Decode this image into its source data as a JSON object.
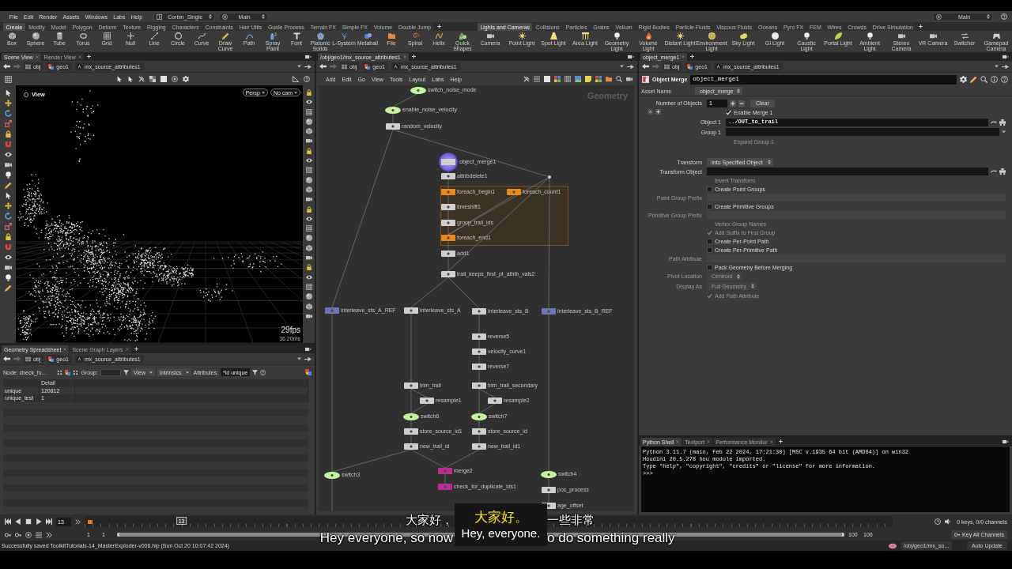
{
  "menu_bar": {
    "items": [
      "File",
      "Edit",
      "Render",
      "Assets",
      "Windows",
      "Labs",
      "Help"
    ],
    "desktop": "Corbin_Single",
    "desk_tab": "Main",
    "right_desk": "Main"
  },
  "shelf_left": {
    "tabs": [
      {
        "label": "Create",
        "selected": true
      },
      {
        "label": "Modify",
        "selected": false
      },
      {
        "label": "Model",
        "selected": false
      },
      {
        "label": "Polygon",
        "selected": false
      },
      {
        "label": "Deform",
        "selected": false
      },
      {
        "label": "Texture",
        "selected": false
      },
      {
        "label": "Rigging",
        "selected": false
      },
      {
        "label": "Characters",
        "selected": false
      },
      {
        "label": "Constraints",
        "selected": false
      },
      {
        "label": "Hair Utils",
        "selected": false
      },
      {
        "label": "Guide Process",
        "selected": false
      },
      {
        "label": "Terrain FX",
        "selected": false
      },
      {
        "label": "Simple FX",
        "selected": false
      },
      {
        "label": "Volume",
        "selected": false
      },
      {
        "label": "Double Jump",
        "selected": false
      }
    ],
    "tools": [
      "Box",
      "Sphere",
      "Tube",
      "Torus",
      "Grid",
      "Null",
      "Line",
      "Circle",
      "Curve",
      "Draw Curve",
      "Path",
      "Spray Paint",
      "Font",
      "Platonic Solids",
      "L-System",
      "Metaball",
      "File",
      "Spiral",
      "Helix",
      "Quick Shapes"
    ]
  },
  "shelf_right": {
    "tabs": [
      {
        "label": "Lights and Cameras",
        "selected": true
      },
      {
        "label": "Collisions",
        "selected": false
      },
      {
        "label": "Particles",
        "selected": false
      },
      {
        "label": "Grains",
        "selected": false
      },
      {
        "label": "Vellum",
        "selected": false
      },
      {
        "label": "Rigid Bodies",
        "selected": false
      },
      {
        "label": "Particle Fluids",
        "selected": false
      },
      {
        "label": "Viscous Fluids",
        "selected": false
      },
      {
        "label": "Oceans",
        "selected": false
      },
      {
        "label": "Pyro FX",
        "selected": false
      },
      {
        "label": "FEM",
        "selected": false
      },
      {
        "label": "Wires",
        "selected": false
      },
      {
        "label": "Crowds",
        "selected": false
      },
      {
        "label": "Drive Simulation",
        "selected": false
      }
    ],
    "tools": [
      "Camera",
      "Point Light",
      "Spot Light",
      "Area Light",
      "Geometry Light",
      "Volume Light",
      "Distant Light",
      "Environment Light",
      "Sky Light",
      "GI Light",
      "Caustic Light",
      "Portal Light",
      "Ambient Light",
      "Stereo Camera",
      "VR Camera",
      "Switcher",
      "Gamepad Camera"
    ]
  },
  "scene_view": {
    "tabs": [
      {
        "label": "Scene View",
        "selected": true
      },
      {
        "label": "Render View",
        "selected": false
      }
    ],
    "path": [
      "obj",
      "geo1",
      "mx_source_attributes1"
    ],
    "view_label": "View",
    "camera_menus": [
      "Persp",
      "No cam"
    ],
    "fps": "29fps",
    "frame_time": "36.20ms"
  },
  "spreadsheet": {
    "tabs": [
      {
        "label": "Geometry Spreadsheet",
        "selected": true
      },
      {
        "label": "Scene Graph Layers",
        "selected": false
      }
    ],
    "path": [
      "obj",
      "geo1",
      "mx_source_attributes1"
    ],
    "node_label": "Node: check_fo...",
    "group_label": "Group:",
    "view_menu": "View",
    "intrinsics_menu": "Intrinsics",
    "attributes_label": "Attributes:",
    "attributes_filter": "*id unique",
    "columns": [
      "Detail"
    ],
    "rows": [
      {
        "name": "unique",
        "value": "120812"
      },
      {
        "name": "unique_test",
        "value": "1"
      }
    ]
  },
  "network_editor": {
    "tabs": [
      {
        "label": "/obj/geo1/mx_source_attributes1",
        "selected": true
      }
    ],
    "path": [
      "obj",
      "geo1",
      "mx_source_attributes1"
    ],
    "menu": [
      "Add",
      "Edit",
      "Go",
      "View",
      "Tools",
      "Layout",
      "Labs",
      "Help"
    ],
    "context_label": "Geometry",
    "nodes": [
      {
        "name": "switch_noise_mode",
        "kind": "switch",
        "selected": false
      },
      {
        "name": "enable_noise_velocity",
        "kind": "switch",
        "selected": false
      },
      {
        "name": "random_velocity",
        "kind": "sop",
        "selected": false
      },
      {
        "name": "object_merge1",
        "kind": "sop",
        "selected": true
      },
      {
        "name": "attribdelete1",
        "kind": "sop",
        "selected": false
      },
      {
        "name": "foreach_begin1",
        "kind": "foreach",
        "selected": false
      },
      {
        "name": "foreach_count1",
        "kind": "foreach",
        "selected": false
      },
      {
        "name": "timeshift1",
        "kind": "sop",
        "selected": false
      },
      {
        "name": "group_trail_ids",
        "kind": "sop",
        "selected": false
      },
      {
        "name": "foreach_end1",
        "kind": "foreach",
        "selected": false
      },
      {
        "name": "add1",
        "kind": "sop",
        "selected": false
      },
      {
        "name": "trail_keeps_first_pt_attrib_vals2",
        "kind": "sop",
        "selected": false
      },
      {
        "name": "interleave_sts_A_REF",
        "kind": "reference",
        "selected": false
      },
      {
        "name": "interleave_sts_A",
        "kind": "sop",
        "selected": false
      },
      {
        "name": "interleave_sts_B",
        "kind": "sop",
        "selected": false
      },
      {
        "name": "interleave_sts_B_REF",
        "kind": "reference",
        "selected": false
      },
      {
        "name": "reverse5",
        "kind": "sop",
        "selected": false
      },
      {
        "name": "velocity_curve1",
        "kind": "sop",
        "selected": false
      },
      {
        "name": "reverse7",
        "kind": "sop",
        "selected": false
      },
      {
        "name": "trim_trail",
        "kind": "sop",
        "selected": false
      },
      {
        "name": "trim_trail_secondary",
        "kind": "sop",
        "selected": false
      },
      {
        "name": "resample1",
        "kind": "sop",
        "selected": false
      },
      {
        "name": "resample2",
        "kind": "sop",
        "selected": false
      },
      {
        "name": "switch6",
        "kind": "switch",
        "selected": false
      },
      {
        "name": "switch7",
        "kind": "switch",
        "selected": false
      },
      {
        "name": "store_source_id1",
        "kind": "sop",
        "selected": false
      },
      {
        "name": "store_source_id",
        "kind": "sop",
        "selected": false
      },
      {
        "name": "new_trail_id",
        "kind": "sop",
        "selected": false
      },
      {
        "name": "new_trail_id1",
        "kind": "sop",
        "selected": false
      },
      {
        "name": "switch3",
        "kind": "switch",
        "selected": false
      },
      {
        "name": "merge2",
        "kind": "merge",
        "selected": false
      },
      {
        "name": "check_for_duplicate_ids1",
        "kind": "merge",
        "selected": false
      },
      {
        "name": "switch4",
        "kind": "switch",
        "selected": false
      },
      {
        "name": "pos_process",
        "kind": "sop",
        "selected": false
      },
      {
        "name": "age_offset",
        "kind": "sop",
        "selected": false
      }
    ]
  },
  "parameters": {
    "tabs": [
      {
        "label": "object_merge1",
        "selected": true
      }
    ],
    "path": [
      "obj",
      "geo1",
      "mx_source_attributes1"
    ],
    "node_type": "Object Merge",
    "node_name": "object_merge1",
    "asset_name_label": "Asset Name",
    "asset_name": "object_merge",
    "rows": [
      {
        "kind": "multiparm",
        "label": "Number of Objects",
        "value": "1",
        "button": "Clear",
        "instances": [
          {
            "rows": [
              {
                "kind": "toggle",
                "label": "Enable Merge 1",
                "checked": true,
                "disabled": false
              },
              {
                "kind": "path",
                "label": "Object 1",
                "value": "../OUT_to_trail",
                "disabled": false
              },
              {
                "kind": "group",
                "label": "Group 1",
                "disabled": false
              },
              {
                "kind": "toggle",
                "label": "Expand Group 1",
                "checked": false,
                "disabled": true
              }
            ]
          }
        ]
      },
      {
        "kind": "menu",
        "label": "Transform",
        "value": "Into Specified Object",
        "disabled": false
      },
      {
        "kind": "path",
        "label": "Transform Object",
        "disabled": false
      },
      {
        "kind": "toggle",
        "label": "Invert Transform",
        "checked": false,
        "disabled": true
      },
      {
        "kind": "toggle",
        "label": "Create Point Groups",
        "checked": false,
        "disabled": false
      },
      {
        "kind": "field",
        "label": "Point Group Prefix",
        "disabled": true
      },
      {
        "kind": "toggle",
        "label": "Create Primitive Groups",
        "checked": false,
        "disabled": false
      },
      {
        "kind": "field",
        "label": "Primitive Group Prefix",
        "disabled": true
      },
      {
        "kind": "toggle",
        "label": "Vertex Group Names",
        "checked": false,
        "disabled": true
      },
      {
        "kind": "toggle",
        "label": "Add Suffix to First Group",
        "checked": true,
        "disabled": true
      },
      {
        "kind": "toggle",
        "label": "Create Per-Point Path",
        "checked": false,
        "disabled": false
      },
      {
        "kind": "toggle",
        "label": "Create Per-Primitive Path",
        "checked": false,
        "disabled": false
      },
      {
        "kind": "field",
        "label": "Path Attribute",
        "disabled": true
      },
      {
        "kind": "toggle",
        "label": "Pack Geometry Before Merging",
        "checked": false,
        "disabled": false
      },
      {
        "kind": "menu",
        "label": "Pivot Location",
        "value": "Centroid",
        "disabled": true
      },
      {
        "kind": "menu",
        "label": "Display As",
        "value": "Full Geometry",
        "disabled": true
      },
      {
        "kind": "toggle",
        "label": "Add Path Attribute",
        "checked": true,
        "disabled": true
      }
    ]
  },
  "python_shell": {
    "tabs": [
      {
        "label": "Python Shell",
        "selected": true
      },
      {
        "label": "Textport",
        "selected": false
      },
      {
        "label": "Performance Monitor",
        "selected": false
      }
    ],
    "lines": [
      "Python 3.11.7 (main, Feb 22 2024, 17:21:30) [MSC v.1935 64 bit (AMD64)] on win32",
      "Houdini 20.5.278 hou module imported.",
      "Type \"help\", \"copyright\", \"credits\" or \"license\" for more information.",
      ">>>"
    ]
  },
  "timeline": {
    "frame": "13",
    "playhead": {
      "label": "13",
      "level": 0.12
    },
    "keys_info": "0 keys, 0/0 channels",
    "start": "1",
    "range_start": "1",
    "range_end": "100",
    "end": "100",
    "key_button": "Key All Channels"
  },
  "status_bar": {
    "message": "Successfully saved ToolkitTutorials-14_MasterExploder-v006.hip (Sun Oct 20 10:07:42 2024)",
    "path": "/obj/geo1/mx_so...",
    "update_mode": "Auto Update"
  },
  "subtitles": {
    "back_zh": [
      "大家好，",
      "一些非常"
    ],
    "back_en": [
      "Hey everyone, so now",
      "o do something really"
    ],
    "front_zh": "大家好。",
    "front_en": "Hey, everyone."
  }
}
